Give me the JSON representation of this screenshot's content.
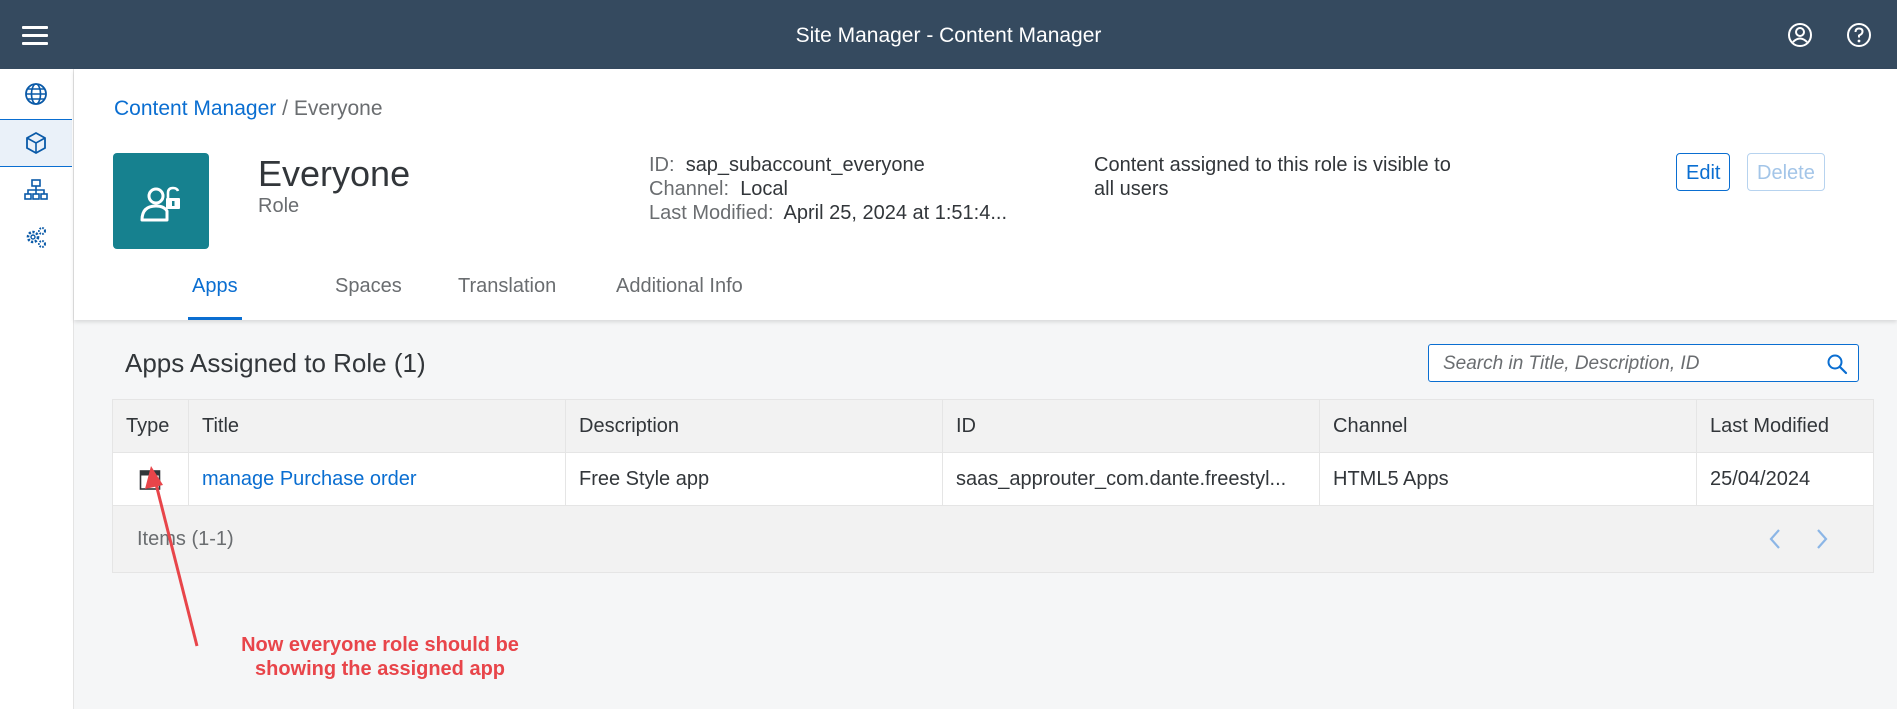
{
  "shell": {
    "title": "Site Manager - Content Manager",
    "icons": [
      "menu-icon",
      "user-icon",
      "help-icon"
    ]
  },
  "sidenav": {
    "items": [
      {
        "icon": "globe-icon",
        "active": false
      },
      {
        "icon": "cube-icon",
        "active": true
      },
      {
        "icon": "hierarchy-icon",
        "active": false
      },
      {
        "icon": "gears-icon",
        "active": false
      }
    ]
  },
  "breadcrumb": {
    "link": "Content Manager",
    "separator": "/",
    "current": "Everyone"
  },
  "object": {
    "title": "Everyone",
    "subtitle": "Role",
    "avatar_icon": "user-unlocked-icon",
    "id_label": "ID:",
    "id_value": "sap_subaccount_everyone",
    "channel_label": "Channel:",
    "channel_value": "Local",
    "modified_label": "Last Modified:",
    "modified_value": "April 25, 2024 at 1:51:4...",
    "description": "Content assigned to this role is visible to all users",
    "edit_label": "Edit",
    "delete_label": "Delete"
  },
  "tabs": [
    {
      "label": "Apps",
      "active": true
    },
    {
      "label": "Spaces",
      "active": false
    },
    {
      "label": "Translation",
      "active": false
    },
    {
      "label": "Additional Info",
      "active": false
    }
  ],
  "section": {
    "title": "Apps Assigned to Role (1)",
    "search_placeholder": "Search in Title, Description, ID"
  },
  "table": {
    "columns": [
      "Type",
      "Title",
      "Description",
      "ID",
      "Channel",
      "Last Modified"
    ],
    "rows": [
      {
        "type_icon": "window-icon",
        "title": "manage Purchase order",
        "description": "Free Style app",
        "id": "saas_approuter_com.dante.freestyl...",
        "channel": "HTML5 Apps",
        "last_modified": "25/04/2024"
      }
    ],
    "footer": "Items (1-1)"
  },
  "annotation": {
    "line1": "Now everyone role should be",
    "line2": "showing the assigned app",
    "color": "#e8454a"
  },
  "colors": {
    "shell": "#354a5f",
    "accent": "#0a6ed1",
    "avatar": "#16818f"
  }
}
